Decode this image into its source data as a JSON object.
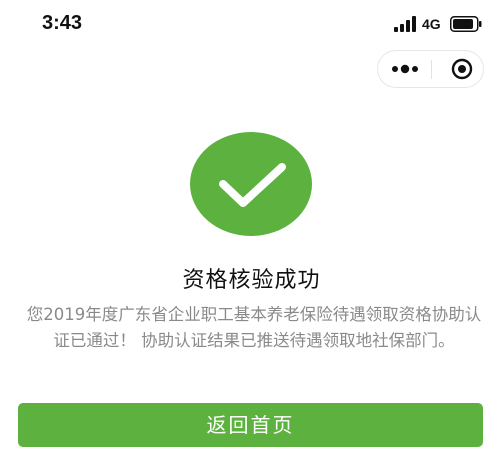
{
  "status_bar": {
    "time": "3:43",
    "network": "4G",
    "icons": [
      "signal-icon",
      "battery-icon"
    ]
  },
  "capsule": {
    "icons": [
      "more-icon",
      "close-icon"
    ]
  },
  "result": {
    "icon": "check-icon",
    "title": "资格核验成功",
    "description": "您2019年度广东省企业职工基本养老保险待遇领取资格协助认证已通过！ 协助认证结果已推送待遇领取地社保部门。"
  },
  "actions": {
    "home_label": "返回首页"
  },
  "colors": {
    "success_green": "#5cb13f",
    "text_primary": "#111111",
    "text_secondary": "#8a8a8a"
  }
}
